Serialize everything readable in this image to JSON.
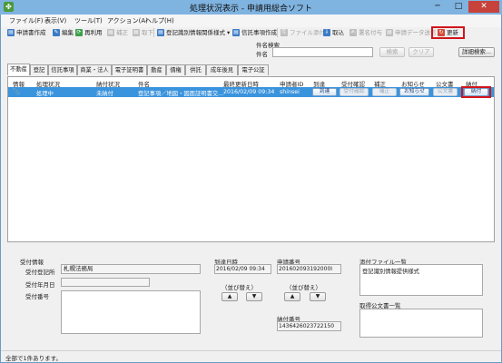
{
  "window": {
    "title": "処理状況表示 - 申請用総合ソフト",
    "icon_glyph": "✤",
    "minimize": "─",
    "maximize": "□",
    "close": "✕"
  },
  "menu": [
    "ファイル(F)",
    "表示(V)",
    "ツール(T)",
    "アクション(A)",
    "ヘルプ(H)"
  ],
  "toolbar": {
    "create": "申請書作成",
    "edit": "編集",
    "reuse": "再利用",
    "correct": "補正",
    "withdraw": "取下",
    "reg_info": "登記識別情報関係様式",
    "trust": "信託事項作成",
    "attach": "ファイル添付",
    "fetch": "取込",
    "sign": "署名付与",
    "send": "申請データ送信",
    "refresh": "更新"
  },
  "search": {
    "section": "件名検索",
    "label": "件名",
    "value": "",
    "search_btn": "検索",
    "clear_btn": "クリア",
    "detail_btn": "詳細検索..."
  },
  "tabs": [
    "不動産",
    "登記",
    "信託事項",
    "商業・法人",
    "電子証明書",
    "動産",
    "債権",
    "供託",
    "成年後見",
    "電子公証"
  ],
  "grid": {
    "headers": [
      "情報",
      "処理状況",
      "納付状況",
      "件名",
      "最終更新日時",
      "申請者ID",
      "到達",
      "受付確認",
      "補正",
      "お知らせ",
      "公文書",
      "納付"
    ],
    "row": {
      "status": "処理中",
      "payment": "未納付",
      "subject": "登記事項／地図・図面証明書交...",
      "updated": "2016/02/09 09:34",
      "user_id": "shinsei",
      "arrival": "到達",
      "receipt": "受付確認",
      "correction": "補正",
      "notice": "お知らせ",
      "doc": "公文書",
      "pay": "納付"
    }
  },
  "detail": {
    "receipt_info": "受付情報",
    "office_label": "受付登記所",
    "office_value": "札幌法務局",
    "date_label": "受付年月日",
    "date_value": "",
    "number_label": "受付番号",
    "number_value": "",
    "arrival_label": "到達日時",
    "arrival_value": "2016/02/09 09:34",
    "app_no_label": "申請番号",
    "app_no_value": "201602093192000I",
    "sort_label": "（並び替え）",
    "up": "▲",
    "down": "▼",
    "pay_no_label": "納付番号",
    "pay_no_value": "1436426023722150",
    "attach_label": "添付ファイル一覧",
    "attach_item": "登記識別情報提供様式",
    "official_label": "取得公文書一覧"
  },
  "status_bar": "全部で1件あります。"
}
